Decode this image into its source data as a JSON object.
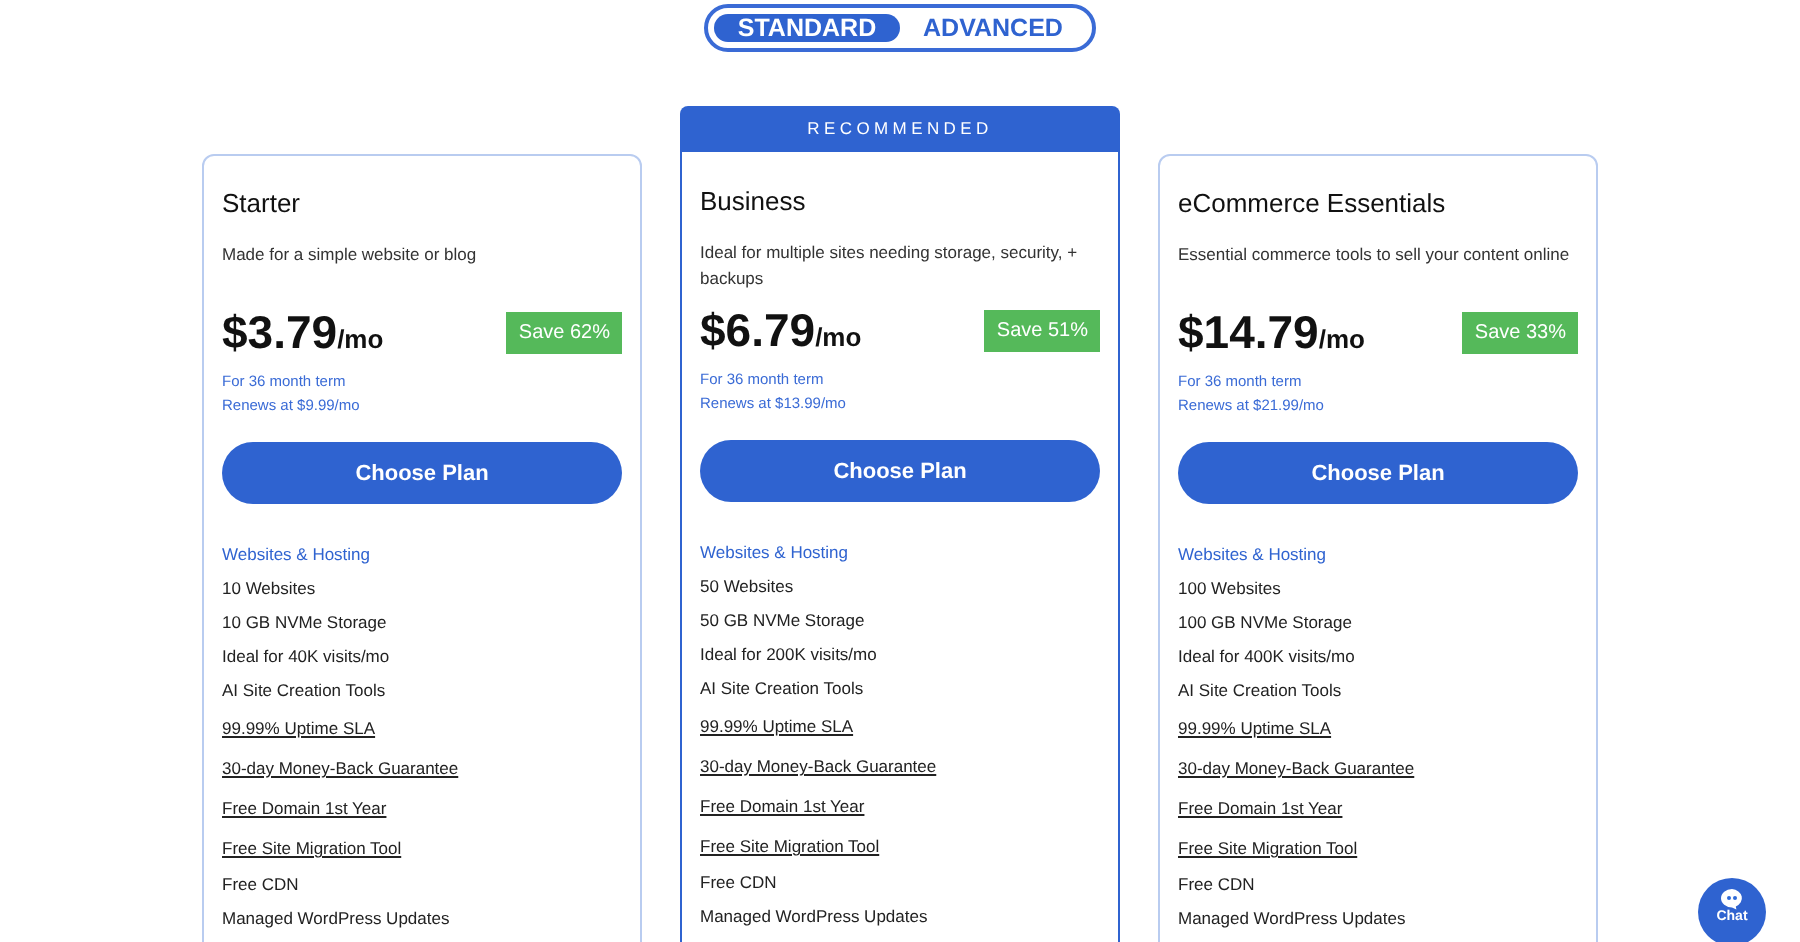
{
  "toggle": [
    {
      "label": "STANDARD",
      "selected": true
    },
    {
      "label": "ADVANCED",
      "selected": false
    }
  ],
  "plans": [
    {
      "name": "Starter",
      "description": "Made for a simple website or blog",
      "price": "$3.79",
      "unit": "/mo",
      "save": "Save 62%",
      "term": "For 36 month term",
      "renews": "Renews at $9.99/mo",
      "button": "Choose Plan",
      "features": [
        {
          "kind": "heading",
          "text": "Websites & Hosting"
        },
        {
          "kind": "text",
          "text": "10 Websites"
        },
        {
          "kind": "text",
          "text": "10 GB NVMe Storage"
        },
        {
          "kind": "text",
          "text": "Ideal for 40K visits/mo"
        },
        {
          "kind": "text",
          "text": "AI Site Creation Tools"
        },
        {
          "kind": "link",
          "text": "99.99% Uptime SLA"
        },
        {
          "kind": "link",
          "text": "30-day Money-Back Guarantee"
        },
        {
          "kind": "link",
          "text": "Free Domain 1st Year"
        },
        {
          "kind": "link",
          "text": "Free Site Migration Tool"
        },
        {
          "kind": "text",
          "text": "Free CDN"
        },
        {
          "kind": "text",
          "text": "Managed WordPress Updates"
        }
      ]
    },
    {
      "badge": "RECOMMENDED",
      "name": "Business",
      "description": "Ideal for multiple sites needing storage, security, + backups",
      "price": "$6.79",
      "unit": "/mo",
      "save": "Save 51%",
      "term": "For 36 month term",
      "renews": "Renews at $13.99/mo",
      "button": "Choose Plan",
      "features": [
        {
          "kind": "heading",
          "text": "Websites & Hosting"
        },
        {
          "kind": "text",
          "text": "50 Websites"
        },
        {
          "kind": "text",
          "text": "50 GB NVMe Storage"
        },
        {
          "kind": "text",
          "text": "Ideal for 200K visits/mo"
        },
        {
          "kind": "text",
          "text": "AI Site Creation Tools"
        },
        {
          "kind": "link",
          "text": "99.99% Uptime SLA"
        },
        {
          "kind": "link",
          "text": "30-day Money-Back Guarantee"
        },
        {
          "kind": "link",
          "text": "Free Domain 1st Year"
        },
        {
          "kind": "link",
          "text": "Free Site Migration Tool"
        },
        {
          "kind": "text",
          "text": "Free CDN"
        },
        {
          "kind": "text",
          "text": "Managed WordPress Updates"
        }
      ]
    },
    {
      "name": "eCommerce Essentials",
      "description": "Essential commerce tools to sell your content online",
      "price": "$14.79",
      "unit": "/mo",
      "save": "Save 33%",
      "term": "For 36 month term",
      "renews": "Renews at $21.99/mo",
      "button": "Choose Plan",
      "features": [
        {
          "kind": "heading",
          "text": "Websites & Hosting"
        },
        {
          "kind": "text",
          "text": "100 Websites"
        },
        {
          "kind": "text",
          "text": "100 GB NVMe Storage"
        },
        {
          "kind": "text",
          "text": "Ideal for 400K visits/mo"
        },
        {
          "kind": "text",
          "text": "AI Site Creation Tools"
        },
        {
          "kind": "link",
          "text": "99.99% Uptime SLA"
        },
        {
          "kind": "link",
          "text": "30-day Money-Back Guarantee"
        },
        {
          "kind": "link",
          "text": "Free Domain 1st Year"
        },
        {
          "kind": "link",
          "text": "Free Site Migration Tool"
        },
        {
          "kind": "text",
          "text": "Free CDN"
        },
        {
          "kind": "text",
          "text": "Managed WordPress Updates"
        }
      ]
    }
  ],
  "chat": {
    "label": "Chat"
  }
}
